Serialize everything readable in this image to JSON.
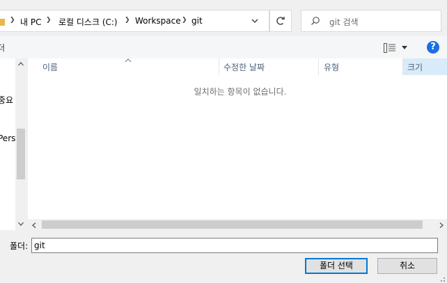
{
  "address_bar": {
    "breadcrumbs": [
      "내 PC",
      "로컬 디스크 (C:)",
      "Workspace",
      "git"
    ],
    "icon": "folder-icon"
  },
  "search": {
    "placeholder": "git 검색",
    "icon": "search-icon"
  },
  "toolbar": {
    "partial_left_label": "더",
    "view_icon": "details-view-icon",
    "help_label": "?"
  },
  "nav_pane": {
    "items": [
      "중요 ·",
      "Person"
    ]
  },
  "file_list": {
    "columns": [
      "이름",
      "수정한 날짜",
      "유형",
      "크기"
    ],
    "sorted_column": "크기",
    "empty_message": "일치하는 항목이 없습니다."
  },
  "footer": {
    "folder_label": "폴더:",
    "folder_value": "git",
    "select_button": "폴더 선택",
    "cancel_button": "취소"
  },
  "colors": {
    "accent": "#0078d7",
    "header_text": "#4c607a",
    "selected_column_bg": "#d9ebf9",
    "help_icon_bg": "#1b6ee3"
  }
}
